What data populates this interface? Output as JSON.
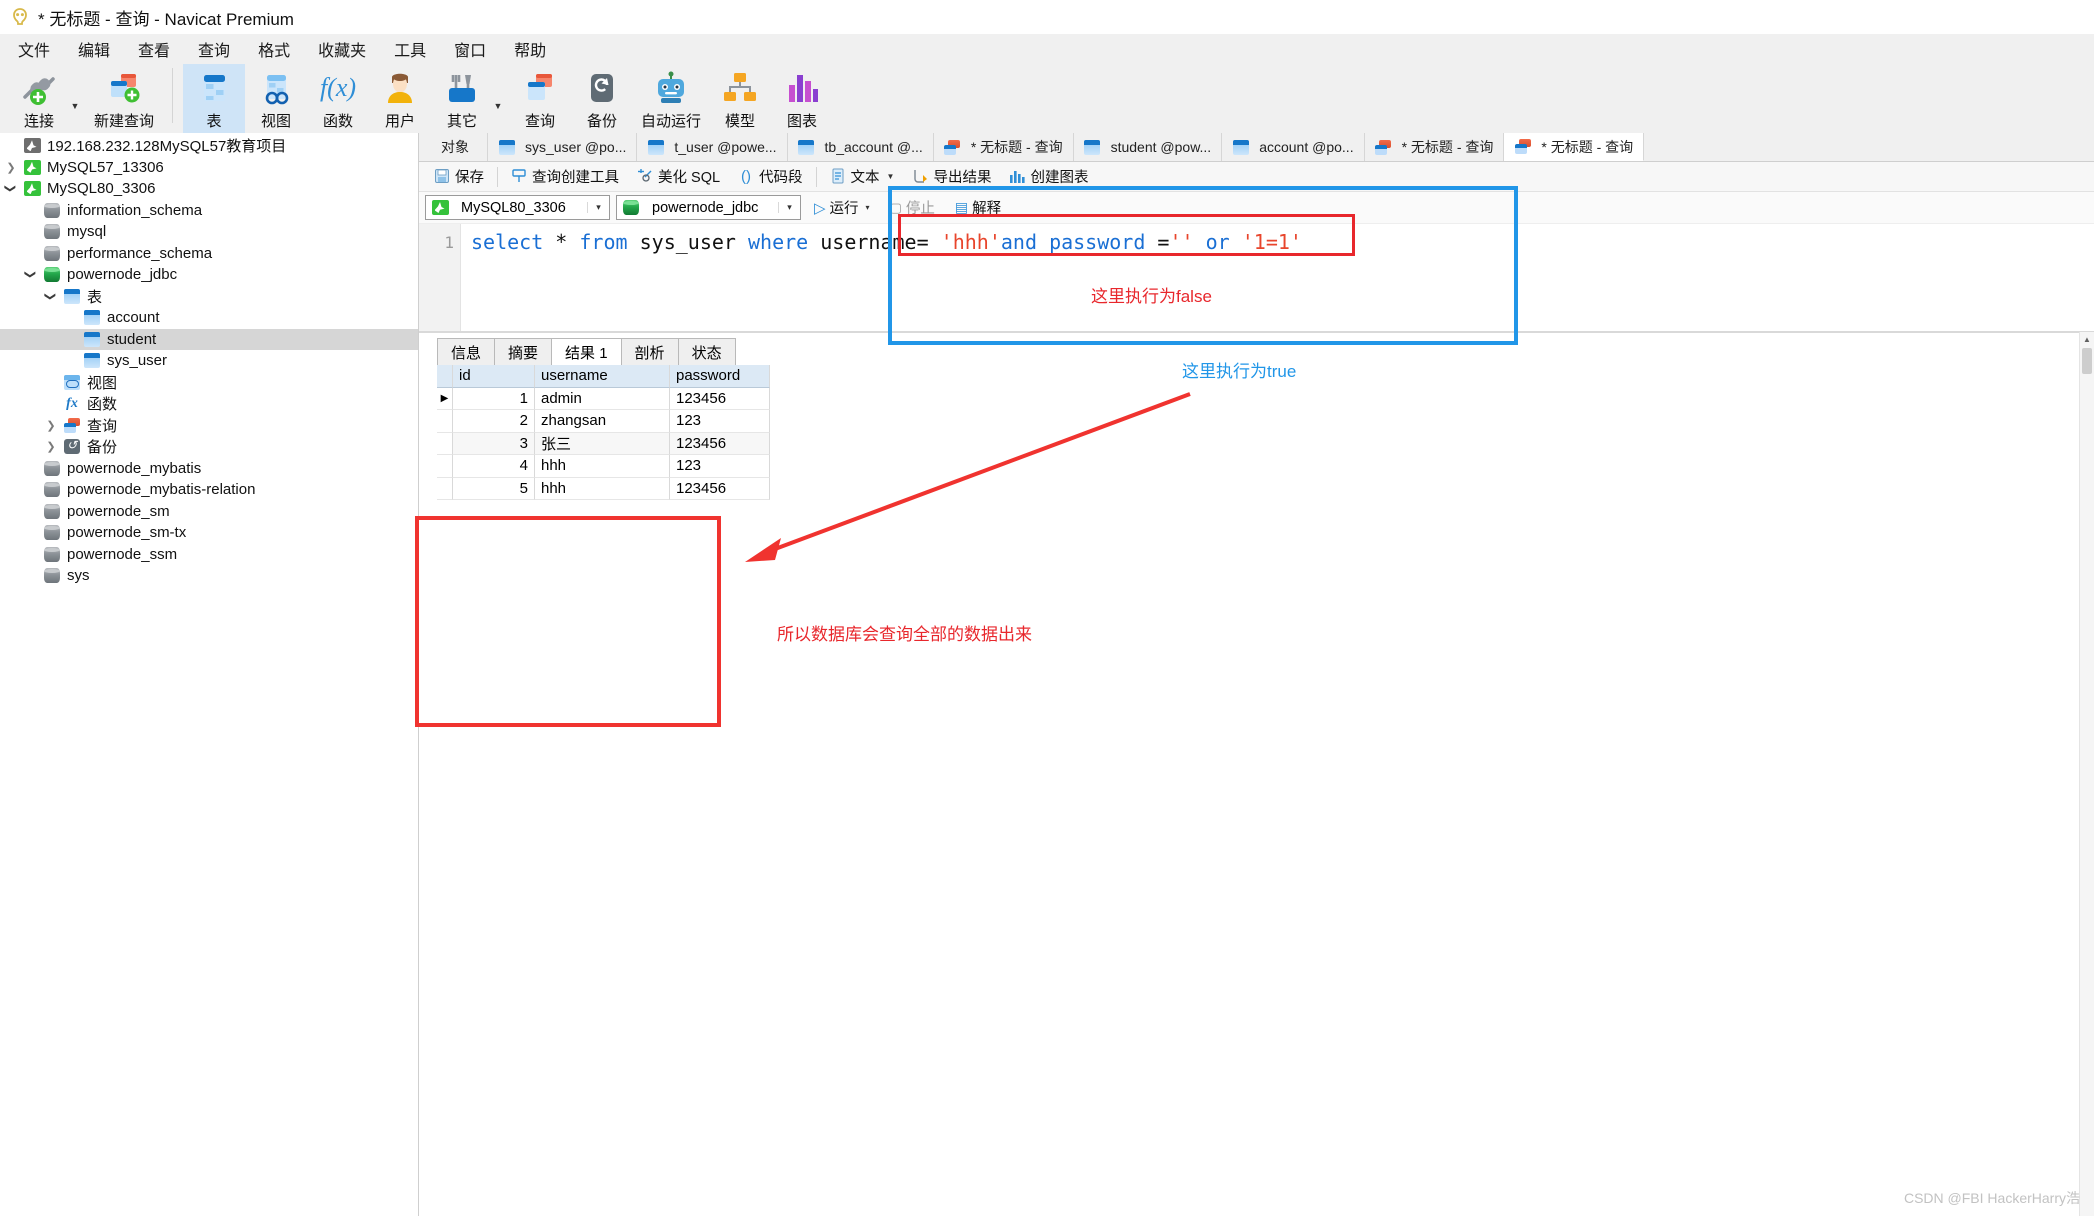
{
  "window": {
    "title": "* 无标题 - 查询 - Navicat Premium",
    "logo_icon": "navicat-logo-icon"
  },
  "menubar": {
    "items": [
      {
        "label": "文件",
        "name": "menu-file"
      },
      {
        "label": "编辑",
        "name": "menu-edit"
      },
      {
        "label": "查看",
        "name": "menu-view"
      },
      {
        "label": "查询",
        "name": "menu-query"
      },
      {
        "label": "格式",
        "name": "menu-format"
      },
      {
        "label": "收藏夹",
        "name": "menu-favorites"
      },
      {
        "label": "工具",
        "name": "menu-tools"
      },
      {
        "label": "窗口",
        "name": "menu-window"
      },
      {
        "label": "帮助",
        "name": "menu-help"
      }
    ]
  },
  "toolbar": {
    "buttons": [
      {
        "label": "连接",
        "icon": "connection-plug-icon",
        "caret": true,
        "active": false
      },
      {
        "label": "新建查询",
        "icon": "new-query-icon",
        "caret": false,
        "active": false
      },
      {
        "label": "表",
        "icon": "table-icon",
        "caret": false,
        "active": true
      },
      {
        "label": "视图",
        "icon": "view-icon",
        "caret": false,
        "active": false
      },
      {
        "label": "函数",
        "icon": "function-fx-icon",
        "caret": false,
        "active": false
      },
      {
        "label": "用户",
        "icon": "user-icon",
        "caret": false,
        "active": false
      },
      {
        "label": "其它",
        "icon": "other-tools-icon",
        "caret": true,
        "active": false
      },
      {
        "label": "查询",
        "icon": "query-icon",
        "caret": false,
        "active": false
      },
      {
        "label": "备份",
        "icon": "backup-icon",
        "caret": false,
        "active": false
      },
      {
        "label": "自动运行",
        "icon": "automation-robot-icon",
        "caret": false,
        "active": false
      },
      {
        "label": "模型",
        "icon": "model-icon",
        "caret": false,
        "active": false
      },
      {
        "label": "图表",
        "icon": "chart-icon",
        "caret": false,
        "active": false
      }
    ]
  },
  "sidebar": {
    "nodes": [
      {
        "label": "192.168.232.128MySQL57教育项目",
        "icon": "dolphin-grey-icon",
        "indent": 0,
        "twisty": "none",
        "selected": false
      },
      {
        "label": "MySQL57_13306",
        "icon": "dolphin-green-icon",
        "indent": 0,
        "twisty": "collapsed",
        "selected": false
      },
      {
        "label": "MySQL80_3306",
        "icon": "dolphin-green-icon",
        "indent": 0,
        "twisty": "expanded",
        "selected": false
      },
      {
        "label": "information_schema",
        "icon": "database-grey-icon",
        "indent": 1,
        "twisty": "none",
        "selected": false
      },
      {
        "label": "mysql",
        "icon": "database-grey-icon",
        "indent": 1,
        "twisty": "none",
        "selected": false
      },
      {
        "label": "performance_schema",
        "icon": "database-grey-icon",
        "indent": 1,
        "twisty": "none",
        "selected": false
      },
      {
        "label": "powernode_jdbc",
        "icon": "database-green-icon",
        "indent": 1,
        "twisty": "expanded",
        "selected": false
      },
      {
        "label": "表",
        "icon": "table-icon",
        "indent": 2,
        "twisty": "expanded",
        "selected": false
      },
      {
        "label": "account",
        "icon": "table-icon",
        "indent": 3,
        "twisty": "none",
        "selected": false
      },
      {
        "label": "student",
        "icon": "table-icon",
        "indent": 3,
        "twisty": "none",
        "selected": true
      },
      {
        "label": "sys_user",
        "icon": "table-icon",
        "indent": 3,
        "twisty": "none",
        "selected": false
      },
      {
        "label": "视图",
        "icon": "view-icon",
        "indent": 2,
        "twisty": "none",
        "selected": false
      },
      {
        "label": "函数",
        "icon": "function-fx-icon",
        "indent": 2,
        "twisty": "none",
        "selected": false
      },
      {
        "label": "查询",
        "icon": "query-icon",
        "indent": 2,
        "twisty": "collapsed",
        "selected": false
      },
      {
        "label": "备份",
        "icon": "backup-icon",
        "indent": 2,
        "twisty": "collapsed",
        "selected": false
      },
      {
        "label": "powernode_mybatis",
        "icon": "database-grey-icon",
        "indent": 1,
        "twisty": "none",
        "selected": false
      },
      {
        "label": "powernode_mybatis-relation",
        "icon": "database-grey-icon",
        "indent": 1,
        "twisty": "none",
        "selected": false
      },
      {
        "label": "powernode_sm",
        "icon": "database-grey-icon",
        "indent": 1,
        "twisty": "none",
        "selected": false
      },
      {
        "label": "powernode_sm-tx",
        "icon": "database-grey-icon",
        "indent": 1,
        "twisty": "none",
        "selected": false
      },
      {
        "label": "powernode_ssm",
        "icon": "database-grey-icon",
        "indent": 1,
        "twisty": "none",
        "selected": false
      },
      {
        "label": "sys",
        "icon": "database-grey-icon",
        "indent": 1,
        "twisty": "none",
        "selected": false
      }
    ]
  },
  "tabstrip": {
    "tabs": [
      {
        "label": "对象",
        "icon": "none",
        "active": false
      },
      {
        "label": "sys_user @po...",
        "icon": "table-icon",
        "active": false
      },
      {
        "label": "t_user @powe...",
        "icon": "table-icon",
        "active": false
      },
      {
        "label": "tb_account @...",
        "icon": "table-icon",
        "active": false
      },
      {
        "label": "* 无标题 - 查询",
        "icon": "query-icon",
        "active": false
      },
      {
        "label": "student @pow...",
        "icon": "table-icon",
        "active": false
      },
      {
        "label": "account @po...",
        "icon": "table-icon",
        "active": false
      },
      {
        "label": "* 无标题 - 查询",
        "icon": "query-icon",
        "active": false
      },
      {
        "label": "* 无标题 - 查询",
        "icon": "query-icon",
        "active": true
      }
    ]
  },
  "query_toolbar": {
    "buttons": [
      {
        "label": "保存",
        "icon": "save-icon",
        "caret": false
      },
      {
        "label": "查询创建工具",
        "icon": "query-builder-icon",
        "caret": false
      },
      {
        "label": "美化 SQL",
        "icon": "beautify-sql-icon",
        "caret": false
      },
      {
        "label": "代码段",
        "icon": "code-snippet-icon",
        "caret": false
      },
      {
        "label": "文本",
        "icon": "text-icon",
        "caret": true
      },
      {
        "label": "导出结果",
        "icon": "export-result-icon",
        "caret": false
      },
      {
        "label": "创建图表",
        "icon": "create-chart-icon",
        "caret": false
      }
    ]
  },
  "connection_bar": {
    "connection": {
      "value": "MySQL80_3306",
      "icon": "dolphin-green-icon"
    },
    "database": {
      "value": "powernode_jdbc",
      "icon": "database-green-icon"
    },
    "run_label": "运行",
    "stop_label": "停止",
    "explain_label": "解释"
  },
  "editor": {
    "line_number": "1",
    "tokens": [
      {
        "t": "select",
        "c": "kw"
      },
      {
        "t": " ",
        "c": "op"
      },
      {
        "t": "*",
        "c": "op"
      },
      {
        "t": " ",
        "c": "op"
      },
      {
        "t": "from",
        "c": "kw"
      },
      {
        "t": " ",
        "c": "op"
      },
      {
        "t": "sys_user",
        "c": "id"
      },
      {
        "t": " ",
        "c": "op"
      },
      {
        "t": "where",
        "c": "kw"
      },
      {
        "t": " ",
        "c": "op"
      },
      {
        "t": "username=",
        "c": "id"
      },
      {
        "t": " ",
        "c": "op"
      },
      {
        "t": "'hhh'",
        "c": "str"
      },
      {
        "t": "and",
        "c": "kw"
      },
      {
        "t": " ",
        "c": "op"
      },
      {
        "t": "password",
        "c": "kw"
      },
      {
        "t": " =",
        "c": "op"
      },
      {
        "t": "''",
        "c": "str"
      },
      {
        "t": " ",
        "c": "op"
      },
      {
        "t": "or",
        "c": "kw"
      },
      {
        "t": " ",
        "c": "op"
      },
      {
        "t": "'1=1'",
        "c": "str"
      }
    ],
    "plain_text": "select * from sys_user where username= 'hhh'and password =''  or  '1=1'"
  },
  "result_panel": {
    "tabs": [
      {
        "label": "信息",
        "active": false
      },
      {
        "label": "摘要",
        "active": false
      },
      {
        "label": "结果 1",
        "active": true
      },
      {
        "label": "剖析",
        "active": false
      },
      {
        "label": "状态",
        "active": false
      }
    ],
    "columns": [
      "id",
      "username",
      "password"
    ],
    "rows": [
      {
        "marker": "▶",
        "id": "1",
        "username": "admin",
        "password": "123456"
      },
      {
        "marker": "",
        "id": "2",
        "username": "zhangsan",
        "password": "123"
      },
      {
        "marker": "",
        "id": "3",
        "username": "张三",
        "password": "123456"
      },
      {
        "marker": "",
        "id": "4",
        "username": "hhh",
        "password": "123"
      },
      {
        "marker": "",
        "id": "5",
        "username": "hhh",
        "password": "123456"
      }
    ]
  },
  "annotations": {
    "false_note": "这里执行为false",
    "true_note": "这里执行为true",
    "result_note": "所以数据库会查询全部的数据出来",
    "colors": {
      "red": "#e8272c",
      "blue": "#2196e8",
      "grid_red": "#f0332f"
    }
  },
  "watermark": "CSDN @FBI HackerHarry浩"
}
